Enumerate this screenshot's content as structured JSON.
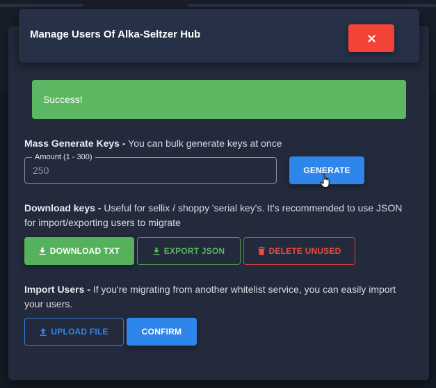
{
  "modal": {
    "title": "Manage Users Of Alka-Seltzer Hub",
    "close_icon": "close-icon"
  },
  "alert": {
    "text": "Success!",
    "color": "#5cb762"
  },
  "mass_generate": {
    "heading": "Mass Generate Keys -",
    "description": " You can bulk generate keys at once",
    "amount_label": "Amount (1 - 300)",
    "amount_placeholder": "250",
    "generate_label": "GENERATE"
  },
  "download": {
    "heading": "Download keys -",
    "description": " Useful for sellix / shoppy 'serial key's. It's recommended to use JSON for import/exporting users to migrate",
    "download_txt_label": "DOWNLOAD TXT",
    "download_icon": "download-icon",
    "export_json_label": "EXPORT JSON",
    "delete_unused_label": "DELETE UNUSED",
    "delete_icon": "trash-icon"
  },
  "import": {
    "heading": "Import Users -",
    "description": " If you're migrating from another whitelist service, you can easily import your users.",
    "upload_label": "UPLOAD FILE",
    "upload_icon": "upload-icon",
    "confirm_label": "CONFIRM"
  },
  "colors": {
    "primary": "#2f86ea",
    "success": "#56b15c",
    "danger": "#f44336",
    "modal_bg": "#222a3b"
  }
}
